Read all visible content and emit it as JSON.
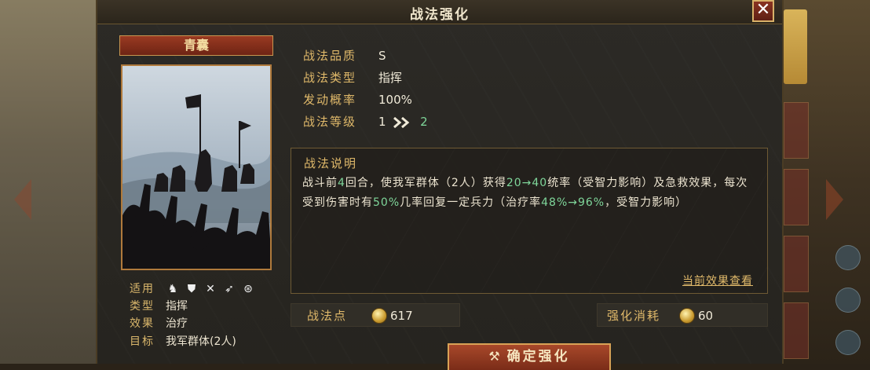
{
  "dialog": {
    "title": "战法强化",
    "close_label": "✕"
  },
  "hero": {
    "name": "青囊",
    "meta": [
      {
        "label": "适用",
        "value": ""
      },
      {
        "label": "类型",
        "value": "指挥"
      },
      {
        "label": "效果",
        "value": "治疗"
      },
      {
        "label": "目标",
        "value": "我军群体(2人)"
      }
    ],
    "troop_icons": [
      "cavalry-icon",
      "shield-icon",
      "bow-icon",
      "spear-icon",
      "wheel-icon"
    ]
  },
  "info": {
    "quality_label": "战法品质",
    "quality_value": "S",
    "type_label": "战法类型",
    "type_value": "指挥",
    "rate_label": "发动概率",
    "rate_value": "100%",
    "level_label": "战法等级",
    "level_current": "1",
    "level_next": "2"
  },
  "description": {
    "title": "战法说明",
    "seg1": "战斗前",
    "seg2": "4",
    "seg3": "回合，使我军群体（2人）获得",
    "seg4": "20→40",
    "seg5": "统率（受智力影响）及急救效果，每次受到伤害时有",
    "seg6": "50%",
    "seg7": "几率回复一定兵力（治疗率",
    "seg8": "48%→96%",
    "seg9": "，受智力影响）",
    "link": "当前效果查看"
  },
  "points": {
    "label": "战法点",
    "value": "617"
  },
  "cost": {
    "label": "强化消耗",
    "value": "60"
  },
  "confirm": {
    "label": "确定强化"
  },
  "colors": {
    "accent": "#e0b96a",
    "highlight": "#7fd69a",
    "button": "#a8482a"
  }
}
